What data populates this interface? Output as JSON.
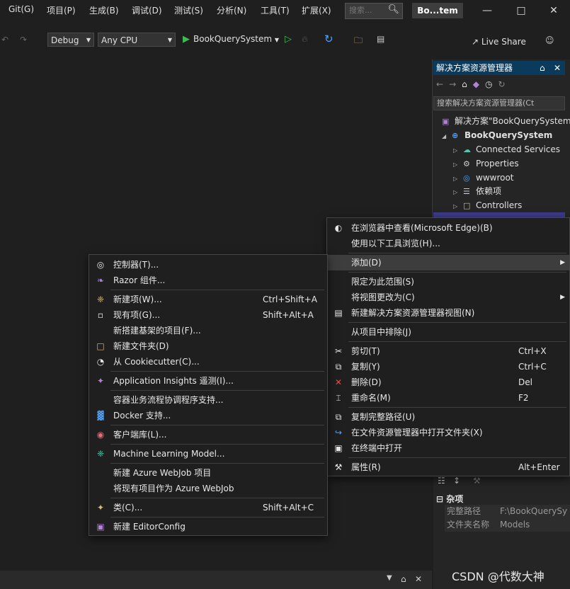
{
  "menubar": {
    "items": [
      "Git(G)",
      "项目(P)",
      "生成(B)",
      "调试(D)",
      "测试(S)",
      "分析(N)",
      "工具(T)",
      "扩展(X)"
    ],
    "search_placeholder": "搜索...",
    "title": "Bo...tem"
  },
  "toolbar": {
    "config": "Debug",
    "platform": "Any CPU",
    "run_target": "BookQuerySystem",
    "live_share": "Live Share"
  },
  "solution_explorer": {
    "title": "解决方案资源管理器",
    "search_placeholder": "搜索解决方案资源管理器(Ct",
    "items": [
      {
        "label": "解决方案\"BookQuerySystem\"",
        "icon": "solution-icon"
      },
      {
        "label": "BookQuerySystem",
        "icon": "project-icon"
      },
      {
        "label": "Connected Services",
        "icon": "connected-services-icon"
      },
      {
        "label": "Properties",
        "icon": "properties-icon"
      },
      {
        "label": "wwwroot",
        "icon": "globe-icon"
      },
      {
        "label": "依赖项",
        "icon": "dependencies-icon"
      },
      {
        "label": "Controllers",
        "icon": "folder-icon"
      }
    ]
  },
  "properties": {
    "category": "杂项",
    "rows": [
      {
        "name": "完整路径",
        "value": "F:\\BookQuerySy"
      },
      {
        "name": "文件夹名称",
        "value": "Models"
      }
    ]
  },
  "context_menu": [
    {
      "label": "在浏览器中查看(Microsoft Edge)(B)",
      "shortcut": "",
      "icon": "browser-icon"
    },
    {
      "label": "使用以下工具浏览(H)...",
      "shortcut": "",
      "icon": ""
    },
    {
      "label": "添加(D)",
      "shortcut": "",
      "icon": "",
      "submenu": true
    },
    {
      "label": "限定为此范围(S)",
      "shortcut": "",
      "icon": ""
    },
    {
      "label": "将视图更改为(C)",
      "shortcut": "",
      "icon": "",
      "submenu": true
    },
    {
      "label": "新建解决方案资源管理器视图(N)",
      "shortcut": "",
      "icon": "new-view-icon"
    },
    {
      "label": "从项目中排除(J)",
      "shortcut": "",
      "icon": ""
    },
    {
      "label": "剪切(T)",
      "shortcut": "Ctrl+X",
      "icon": "cut-icon"
    },
    {
      "label": "复制(Y)",
      "shortcut": "Ctrl+C",
      "icon": "copy-icon"
    },
    {
      "label": "删除(D)",
      "shortcut": "Del",
      "icon": "delete-icon"
    },
    {
      "label": "重命名(M)",
      "shortcut": "F2",
      "icon": "rename-icon"
    },
    {
      "label": "复制完整路径(U)",
      "shortcut": "",
      "icon": "copy-path-icon"
    },
    {
      "label": "在文件资源管理器中打开文件夹(X)",
      "shortcut": "",
      "icon": "open-folder-icon"
    },
    {
      "label": "在终端中打开",
      "shortcut": "",
      "icon": "terminal-icon"
    },
    {
      "label": "属性(R)",
      "shortcut": "Alt+Enter",
      "icon": "wrench-icon"
    }
  ],
  "add_submenu": [
    {
      "label": "控制器(T)...",
      "shortcut": "",
      "icon": "controller-icon"
    },
    {
      "label": "Razor 组件...",
      "shortcut": "",
      "icon": "razor-icon"
    },
    {
      "label": "新建项(W)...",
      "shortcut": "Ctrl+Shift+A",
      "icon": "new-item-icon"
    },
    {
      "label": "现有项(G)...",
      "shortcut": "Shift+Alt+A",
      "icon": "existing-item-icon"
    },
    {
      "label": "新搭建基架的项目(F)...",
      "shortcut": "",
      "icon": ""
    },
    {
      "label": "新建文件夹(D)",
      "shortcut": "",
      "icon": "new-folder-icon"
    },
    {
      "label": "从 Cookiecutter(C)...",
      "shortcut": "",
      "icon": "cookiecutter-icon"
    },
    {
      "label": "Application Insights 遥测(I)...",
      "shortcut": "",
      "icon": "insights-icon"
    },
    {
      "label": "容器业务流程协调程序支持...",
      "shortcut": "",
      "icon": ""
    },
    {
      "label": "Docker 支持...",
      "shortcut": "",
      "icon": "docker-icon"
    },
    {
      "label": "客户端库(L)...",
      "shortcut": "",
      "icon": "client-library-icon"
    },
    {
      "label": "Machine Learning Model...",
      "shortcut": "",
      "icon": "ml-icon"
    },
    {
      "label": "新建 Azure WebJob 项目",
      "shortcut": "",
      "icon": ""
    },
    {
      "label": "将现有项目作为 Azure WebJob",
      "shortcut": "",
      "icon": ""
    },
    {
      "label": "类(C)...",
      "shortcut": "Shift+Alt+C",
      "icon": "class-icon"
    },
    {
      "label": "新建 EditorConfig",
      "shortcut": "",
      "icon": "editorconfig-icon"
    }
  ],
  "watermark": "CSDN @代数大神"
}
